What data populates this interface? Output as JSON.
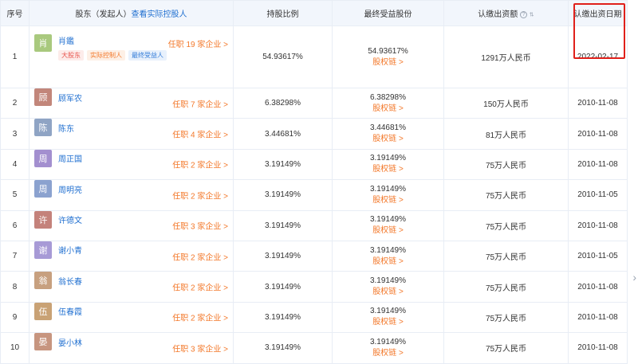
{
  "headers": {
    "index": "序号",
    "shareholder": "股东（发起人）",
    "view_controller": "查看实际控股人",
    "holding_ratio": "持股比例",
    "beneficial": "最终受益股份",
    "subscribed_amount": "认缴出资额",
    "subscribed_date": "认缴出资日期"
  },
  "colors": {
    "header_bg": "#f2f6fc",
    "link_blue": "#1f6fd0",
    "link_orange": "#f3782a",
    "highlight_red": "#e0201a"
  },
  "tags": [
    "大股东",
    "实际控制人",
    "最终受益人"
  ],
  "rows": [
    {
      "index": "1",
      "avatar": "肖",
      "avatar_color": "#a9c97e",
      "name": "肖鑑",
      "posts": "任职 19 家企业 >",
      "ratio": "54.93617%",
      "beneficial": "54.93617%",
      "beneficial_link": "股权链 >",
      "amount": "1291万人民币",
      "date": "2022-02-17"
    },
    {
      "index": "2",
      "avatar": "顾",
      "avatar_color": "#c2867a",
      "name": "顾军农",
      "posts": "任职 7 家企业 >",
      "ratio": "6.38298%",
      "beneficial": "6.38298%",
      "beneficial_link": "股权链 >",
      "amount": "150万人民币",
      "date": "2010-11-08"
    },
    {
      "index": "3",
      "avatar": "陈",
      "avatar_color": "#8fa4c4",
      "name": "陈东",
      "posts": "任职 4 家企业 >",
      "ratio": "3.44681%",
      "beneficial": "3.44681%",
      "beneficial_link": "股权链 >",
      "amount": "81万人民币",
      "date": "2010-11-08"
    },
    {
      "index": "4",
      "avatar": "周",
      "avatar_color": "#a38fcf",
      "name": "周正国",
      "posts": "任职 2 家企业 >",
      "ratio": "3.19149%",
      "beneficial": "3.19149%",
      "beneficial_link": "股权链 >",
      "amount": "75万人民币",
      "date": "2010-11-08"
    },
    {
      "index": "5",
      "avatar": "周",
      "avatar_color": "#8ba2cf",
      "name": "周明亮",
      "posts": "任职 2 家企业 >",
      "ratio": "3.19149%",
      "beneficial": "3.19149%",
      "beneficial_link": "股权链 >",
      "amount": "75万人民币",
      "date": "2010-11-05"
    },
    {
      "index": "6",
      "avatar": "许",
      "avatar_color": "#c4827b",
      "name": "许德文",
      "posts": "任职 3 家企业 >",
      "ratio": "3.19149%",
      "beneficial": "3.19149%",
      "beneficial_link": "股权链 >",
      "amount": "75万人民币",
      "date": "2010-11-08"
    },
    {
      "index": "7",
      "avatar": "谢",
      "avatar_color": "#a79ad6",
      "name": "谢小青",
      "posts": "任职 2 家企业 >",
      "ratio": "3.19149%",
      "beneficial": "3.19149%",
      "beneficial_link": "股权链 >",
      "amount": "75万人民币",
      "date": "2010-11-05"
    },
    {
      "index": "8",
      "avatar": "翁",
      "avatar_color": "#c7a07f",
      "name": "翁长春",
      "posts": "任职 2 家企业 >",
      "ratio": "3.19149%",
      "beneficial": "3.19149%",
      "beneficial_link": "股权链 >",
      "amount": "75万人民币",
      "date": "2010-11-08"
    },
    {
      "index": "9",
      "avatar": "伍",
      "avatar_color": "#c9a275",
      "name": "伍春霞",
      "posts": "任职 2 家企业 >",
      "ratio": "3.19149%",
      "beneficial": "3.19149%",
      "beneficial_link": "股权链 >",
      "amount": "75万人民币",
      "date": "2010-11-08"
    },
    {
      "index": "10",
      "avatar": "晏",
      "avatar_color": "#c7957f",
      "name": "晏小林",
      "posts": "任职 3 家企业 >",
      "ratio": "3.19149%",
      "beneficial": "3.19149%",
      "beneficial_link": "股权链 >",
      "amount": "75万人民币",
      "date": "2010-11-08"
    }
  ]
}
